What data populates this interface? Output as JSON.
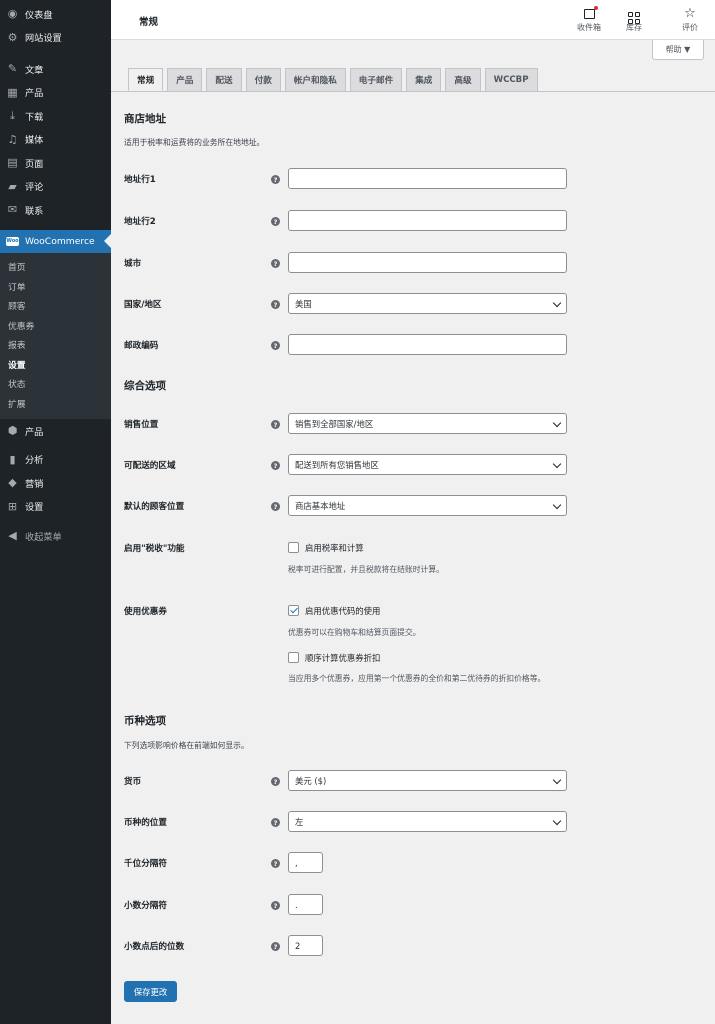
{
  "sidebar": {
    "items": [
      {
        "label": "仪表盘",
        "icon": "dashboard-icon",
        "glyph": "◉"
      },
      {
        "label": "网站设置",
        "icon": "gear-icon",
        "glyph": "⚙"
      },
      {
        "label": "文章",
        "icon": "pin-icon",
        "glyph": "✎"
      },
      {
        "label": "产品",
        "icon": "grid-icon",
        "glyph": "▦"
      },
      {
        "label": "下载",
        "icon": "download-icon",
        "glyph": "⤓"
      },
      {
        "label": "媒体",
        "icon": "media-icon",
        "glyph": "♫"
      },
      {
        "label": "页面",
        "icon": "page-icon",
        "glyph": "▤"
      },
      {
        "label": "评论",
        "icon": "comment-icon",
        "glyph": "▰"
      },
      {
        "label": "联系",
        "icon": "mail-icon",
        "glyph": "✉"
      }
    ],
    "woocommerce": {
      "label": "WooCommerce",
      "icon_text": "Woo"
    },
    "woo_submenu": [
      "首页",
      "订单",
      "顾客",
      "优惠券",
      "报表",
      "设置",
      "状态",
      "扩展"
    ],
    "lower_items": [
      {
        "label": "产品",
        "icon": "box-icon",
        "glyph": "⬢"
      },
      {
        "label": "分析",
        "icon": "analytics-icon",
        "glyph": "▮"
      },
      {
        "label": "营销",
        "icon": "megaphone-icon",
        "glyph": "📣"
      },
      {
        "label": "设置",
        "icon": "settings-icon",
        "glyph": "⊞"
      },
      {
        "label": "收起菜单",
        "icon": "collapse-icon",
        "glyph": "◀"
      }
    ]
  },
  "header": {
    "title": "常规",
    "actions": {
      "inbox": "收件箱",
      "library": "库存",
      "rate": "评价"
    },
    "help": "帮助 ▼"
  },
  "tabs": [
    "常规",
    "产品",
    "配送",
    "付款",
    "帐户和隐私",
    "电子邮件",
    "集成",
    "高级",
    "WCCBP"
  ],
  "store_address": {
    "title": "商店地址",
    "desc": "适用于税率和运费将的业务所在地地址。",
    "address1_label": "地址行1",
    "address2_label": "地址行2",
    "city_label": "城市",
    "country_label": "国家/地区",
    "country_value": "美国",
    "postcode_label": "邮政编码"
  },
  "general": {
    "title": "综合选项",
    "selling_label": "销售位置",
    "selling_value": "销售到全部国家/地区",
    "shipping_label": "可配送的区域",
    "shipping_value": "配送到所有您销售地区",
    "customer_label": "默认的顾客位置",
    "customer_value": "商店基本地址",
    "tax_label": "启用\"税收\"功能",
    "tax_check": "启用税率和计算",
    "tax_desc": "税率可进行配置，并且税款将在结账时计算。",
    "coupon_label": "使用优惠券",
    "coupon_check": "启用优惠代码的使用",
    "coupon_desc": "优惠券可以在购物车和结算页面提交。",
    "sequential_check": "顺序计算优惠券折扣",
    "sequential_desc": "当应用多个优惠券，应用第一个优惠券的全价和第二优待券的折扣价格等。"
  },
  "currency": {
    "title": "币种选项",
    "desc": "下列选项影响价格在前端如何显示。",
    "currency_label": "货币",
    "currency_value": "美元 ($)",
    "position_label": "币种的位置",
    "position_value": "左",
    "thousand_label": "千位分隔符",
    "thousand_value": ",",
    "decimal_label": "小数分隔符",
    "decimal_value": ".",
    "decimals_label": "小数点后的位数",
    "decimals_value": "2"
  },
  "save_label": "保存更改",
  "colors": {
    "accent": "#2271b1",
    "sidebar": "#1d2327"
  }
}
